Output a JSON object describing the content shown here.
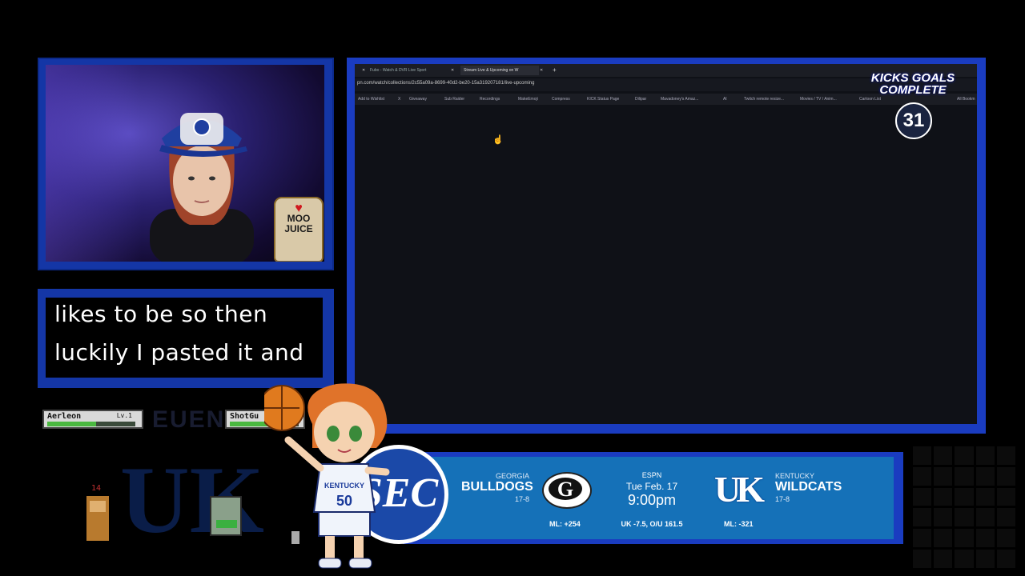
{
  "browser": {
    "tabs": [
      "Fubo - Watch & DVR Live Sport",
      "Stream Live & Upcoming on W"
    ],
    "new_tab": "+",
    "url": "pn.com/watch/collections/2c55a09a-8699-40d2-be20-15a319207181/live-upcoming",
    "bookmarks": [
      "Add to Wishlist",
      "X",
      "Giveaway",
      "Sub Raider",
      "Recordings",
      "MakeEmoji",
      "Compress",
      "KICK Status Page",
      "Dilipar",
      "Mavadoney's Amaz...",
      "Al",
      "Twitch remote resize...",
      "Movies / TV / Anim...",
      "Cartoon List",
      "All Bookm"
    ]
  },
  "goals": {
    "title_line1": "KICKS GOALS",
    "title_line2": "COMPLETE",
    "count": "31"
  },
  "webcam": {
    "cup_line1": "MOO",
    "cup_line2": "JUICE"
  },
  "captions": {
    "line1": "likes to be so then",
    "line2": "luckily I pasted it and"
  },
  "hud": [
    {
      "name": "Aerleon",
      "level": "Lv.1",
      "hp": 0.55
    },
    {
      "name": "ShotGu",
      "level": "",
      "hp": 0.6
    }
  ],
  "faint_text": "EUENA",
  "sprite_number": "14",
  "mascot_jersey": "50",
  "scoreboard": {
    "sec": "SEC",
    "away": {
      "school": "GEORGIA",
      "name": "BULLDOGS",
      "record": "17-8",
      "ml": "ML: +254",
      "logo": "G"
    },
    "home": {
      "school": "KENTUCKY",
      "name": "WILDCATS",
      "record": "17-8",
      "ml": "ML: -321",
      "logo": "UK"
    },
    "network": "ESPN",
    "date": "Tue Feb. 17",
    "time": "9:00pm",
    "line": "UK -7.5, O/U 161.5"
  },
  "colors": {
    "frame_blue": "#1436a6",
    "score_blue": "#1571b8",
    "uk_navy": "#0c2150"
  }
}
